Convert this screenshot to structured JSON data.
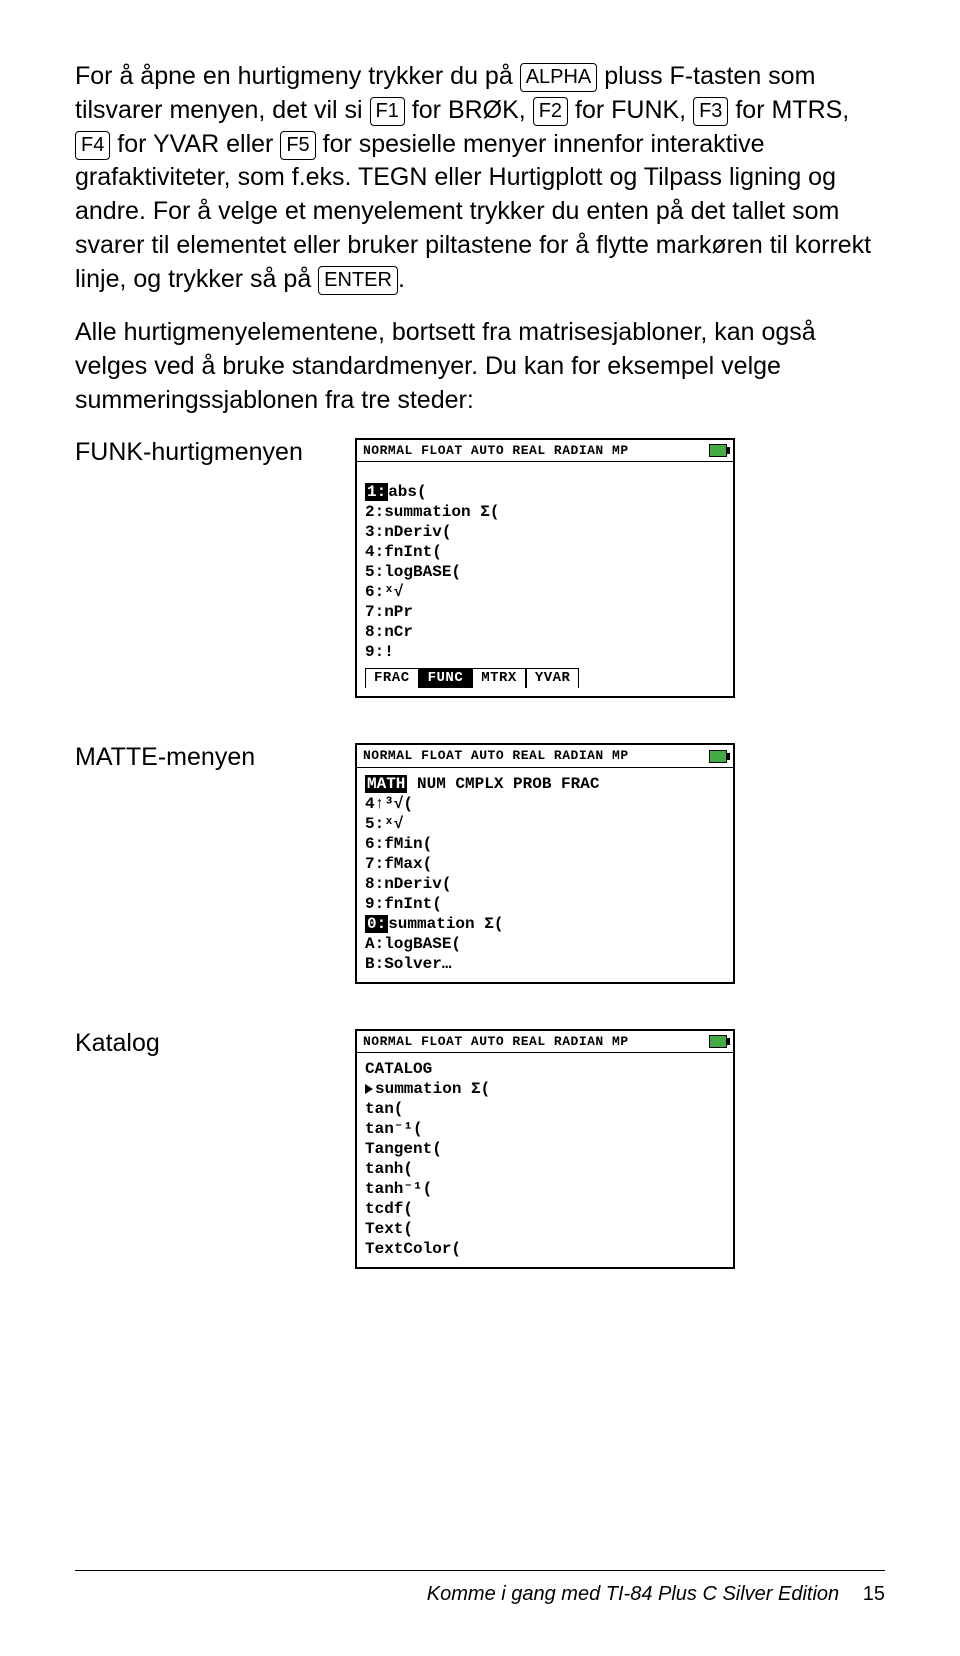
{
  "para1_a": "For å åpne en hurtigmeny trykker du på ",
  "key_alpha": "ALPHA",
  "para1_b": " pluss F-tasten som tilsvarer menyen, det vil si ",
  "key_f1": "F1",
  "para1_c": " for BRØK, ",
  "key_f2": "F2",
  "para1_d": " for FUNK, ",
  "key_f3": "F3",
  "para1_e": " for MTRS, ",
  "key_f4": "F4",
  "para1_f": " for YVAR eller ",
  "key_f5": "F5",
  "para1_g": " for spesielle menyer innenfor interaktive grafaktiviteter, som f.eks. TEGN eller Hurtigplott og Tilpass ligning og andre. For å velge et menyelement trykker du enten på det tallet som svarer til elementet eller bruker piltastene for å flytte markøren til korrekt linje, og trykker så på ",
  "key_enter": "ENTER",
  "para1_h": ".",
  "para2": "Alle hurtigmenyelementene, bortsett fra matrisesjabloner, kan også velges ved å bruke standardmenyer. Du kan for eksempel velge summeringssjablonen fra tre steder:",
  "labels": {
    "funk": "FUNK-hurtigmenyen",
    "matte": "MATTE-menyen",
    "katalog": "Katalog"
  },
  "status_text": "NORMAL FLOAT AUTO REAL RADIAN MP",
  "screens": {
    "funk": {
      "sel_key": "1:",
      "sel_val": "abs(",
      "rest": [
        "2:summation Σ(",
        "3:nDeriv(",
        "4:fnInt(",
        "5:logBASE(",
        "6:ˣ√",
        "7:nPr",
        "8:nCr",
        "9:!"
      ],
      "tabs": [
        "FRAC",
        "FUNC",
        "MTRX",
        "YVAR"
      ],
      "active_tab": 1
    },
    "matte": {
      "header_sel": "MATH",
      "header_rest": " NUM CMPLX PROB FRAC",
      "before": [
        "4↑³√(",
        "5:ˣ√",
        "6:fMin(",
        "7:fMax(",
        "8:nDeriv(",
        "9:fnInt("
      ],
      "sel_key": "0:",
      "sel_val": "summation Σ(",
      "after": [
        "A:logBASE(",
        "B:Solver…"
      ]
    },
    "katalog": {
      "title": "CATALOG",
      "sel": "summation Σ(",
      "rest": [
        " tan(",
        " tan⁻¹(",
        " Tangent(",
        " tanh(",
        " tanh⁻¹(",
        " tcdf(",
        " Text(",
        " TextColor("
      ]
    }
  },
  "footer": {
    "title": "Komme i gang med TI-84 Plus C Silver Edition",
    "page": "15"
  }
}
